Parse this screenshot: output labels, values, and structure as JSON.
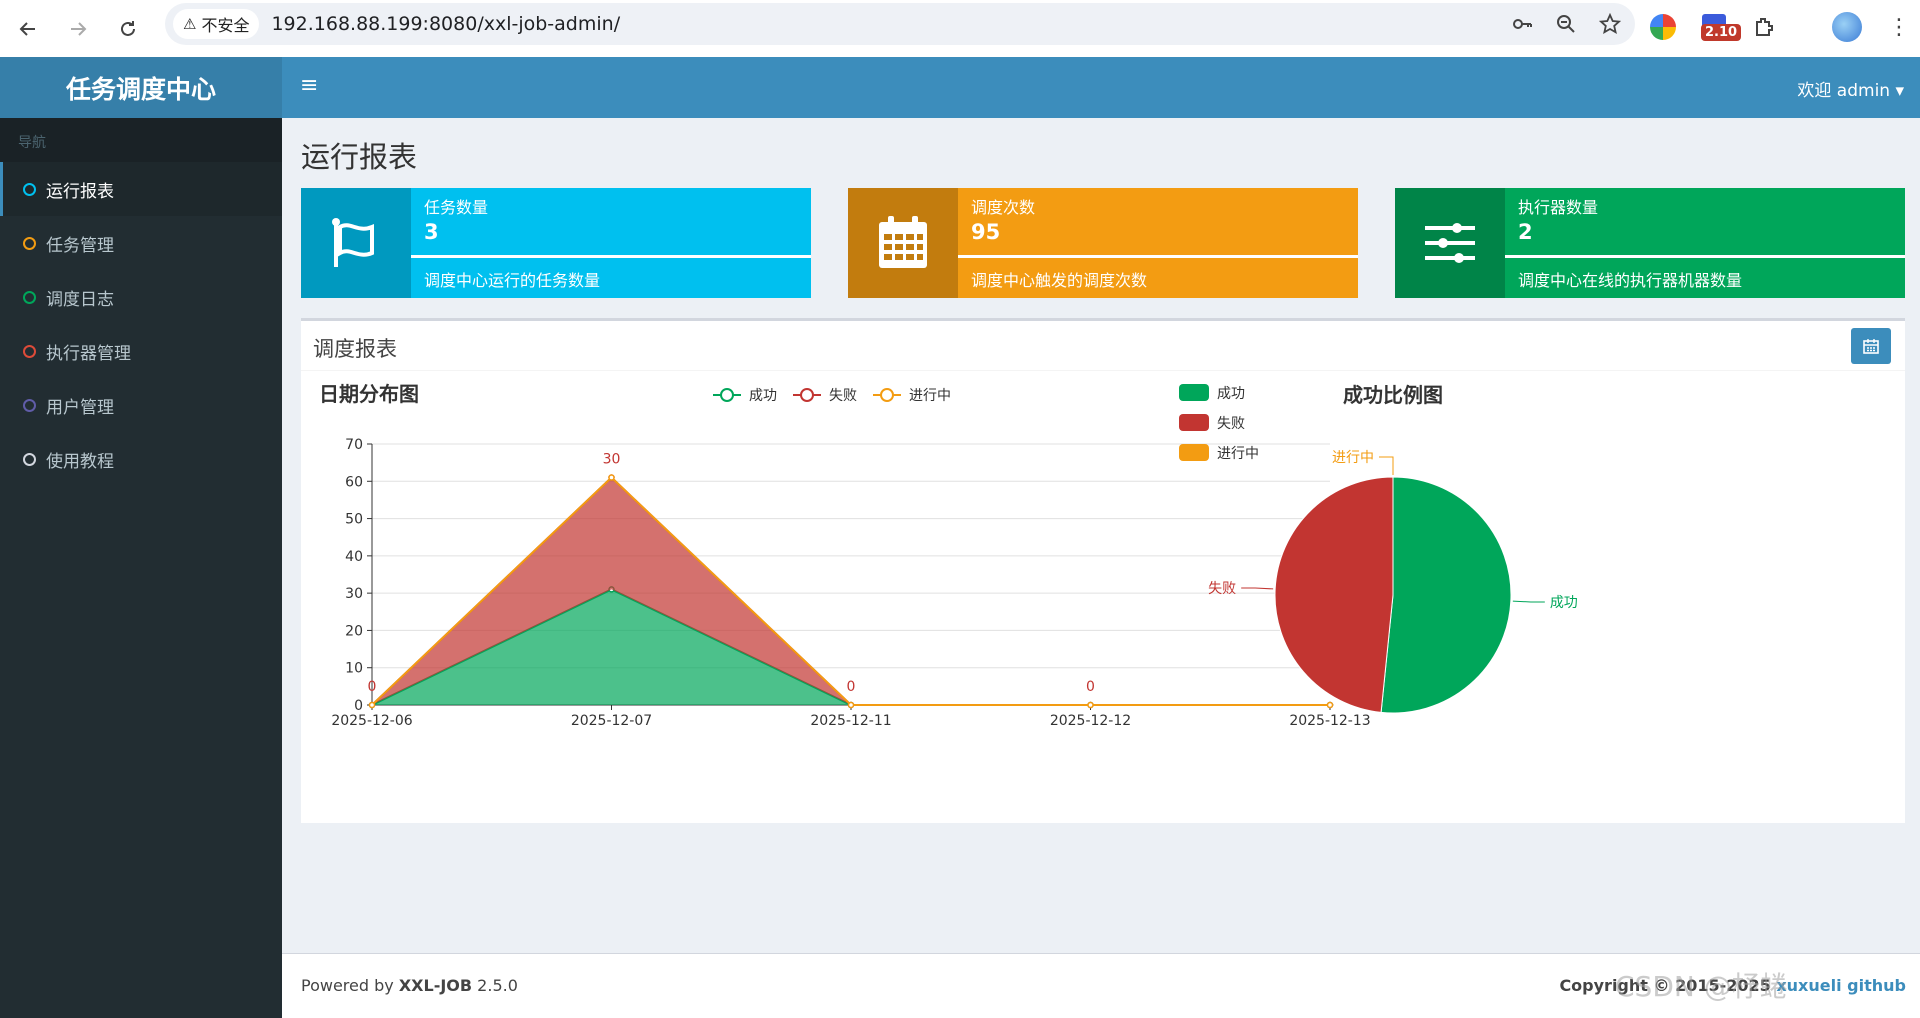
{
  "browser": {
    "back_icon": "arrow-left-icon",
    "forward_icon": "arrow-right-icon",
    "reload_icon": "reload-icon",
    "security_label": "不安全",
    "url": "192.168.88.199:8080/xxl-job-admin/",
    "extension_badge": "2.10"
  },
  "header": {
    "logo": "任务调度中心",
    "menu_toggle": "≡",
    "user": "欢迎 admin ▾"
  },
  "sidebar": {
    "section_label": "导航",
    "items": [
      {
        "label": "运行报表",
        "color": "#00c0ef",
        "active": true
      },
      {
        "label": "任务管理",
        "color": "#f39c12",
        "active": false
      },
      {
        "label": "调度日志",
        "color": "#00a65a",
        "active": false
      },
      {
        "label": "执行器管理",
        "color": "#dd4b39",
        "active": false
      },
      {
        "label": "用户管理",
        "color": "#605ca8",
        "active": false
      },
      {
        "label": "使用教程",
        "color": "#d2d6de",
        "active": false
      }
    ]
  },
  "page": {
    "title": "运行报表"
  },
  "info_boxes": [
    {
      "title": "任务数量",
      "value": "3",
      "desc": "调度中心运行的任务数量",
      "icon": "flag-icon",
      "color": "#00c0ef",
      "progress": 1.0
    },
    {
      "title": "调度次数",
      "value": "95",
      "desc": "调度中心触发的调度次数",
      "icon": "calendar-icon",
      "color": "#f39c12",
      "progress": 1.0
    },
    {
      "title": "执行器数量",
      "value": "2",
      "desc": "调度中心在线的执行器机器数量",
      "icon": "sliders-icon",
      "color": "#00a65a",
      "progress": 1.0
    }
  ],
  "report_box": {
    "title": "调度报表",
    "date_button_icon": "calendar-icon"
  },
  "chart_data": [
    {
      "type": "area",
      "title": "日期分布图",
      "stacked": true,
      "categories": [
        "2025-12-06",
        "2025-12-07",
        "2025-12-11",
        "2025-12-12",
        "2025-12-13"
      ],
      "series": [
        {
          "name": "成功",
          "color": "#00a65a",
          "values": [
            0,
            31,
            0,
            0,
            0
          ]
        },
        {
          "name": "失败",
          "color": "#c23531",
          "values": [
            0,
            30,
            0,
            0,
            0
          ]
        },
        {
          "name": "进行中",
          "color": "#f39c12",
          "values": [
            0,
            0,
            0,
            0,
            0
          ]
        }
      ],
      "data_labels": [
        "0",
        "30",
        "0",
        "0",
        "0"
      ],
      "ylim": [
        0,
        70
      ],
      "yticks": [
        0,
        10,
        20,
        30,
        40,
        50,
        60,
        70
      ],
      "grid": true,
      "legend": "top-center"
    },
    {
      "type": "pie",
      "title": "成功比例图",
      "slices": [
        {
          "name": "成功",
          "value": 64,
          "color": "#00a65a"
        },
        {
          "name": "失败",
          "value": 60,
          "color": "#c23531"
        },
        {
          "name": "进行中",
          "value": 0,
          "color": "#f39c12"
        }
      ],
      "legend": "top-left"
    }
  ],
  "footer": {
    "powered_prefix": "Powered by ",
    "brand": "XXL-JOB",
    "version": " 2.5.0",
    "copyright": "Copyright © 2015-2025",
    "link1": "xuxueli",
    "link2": "github"
  },
  "watermark": "CSDN @杼蜷"
}
